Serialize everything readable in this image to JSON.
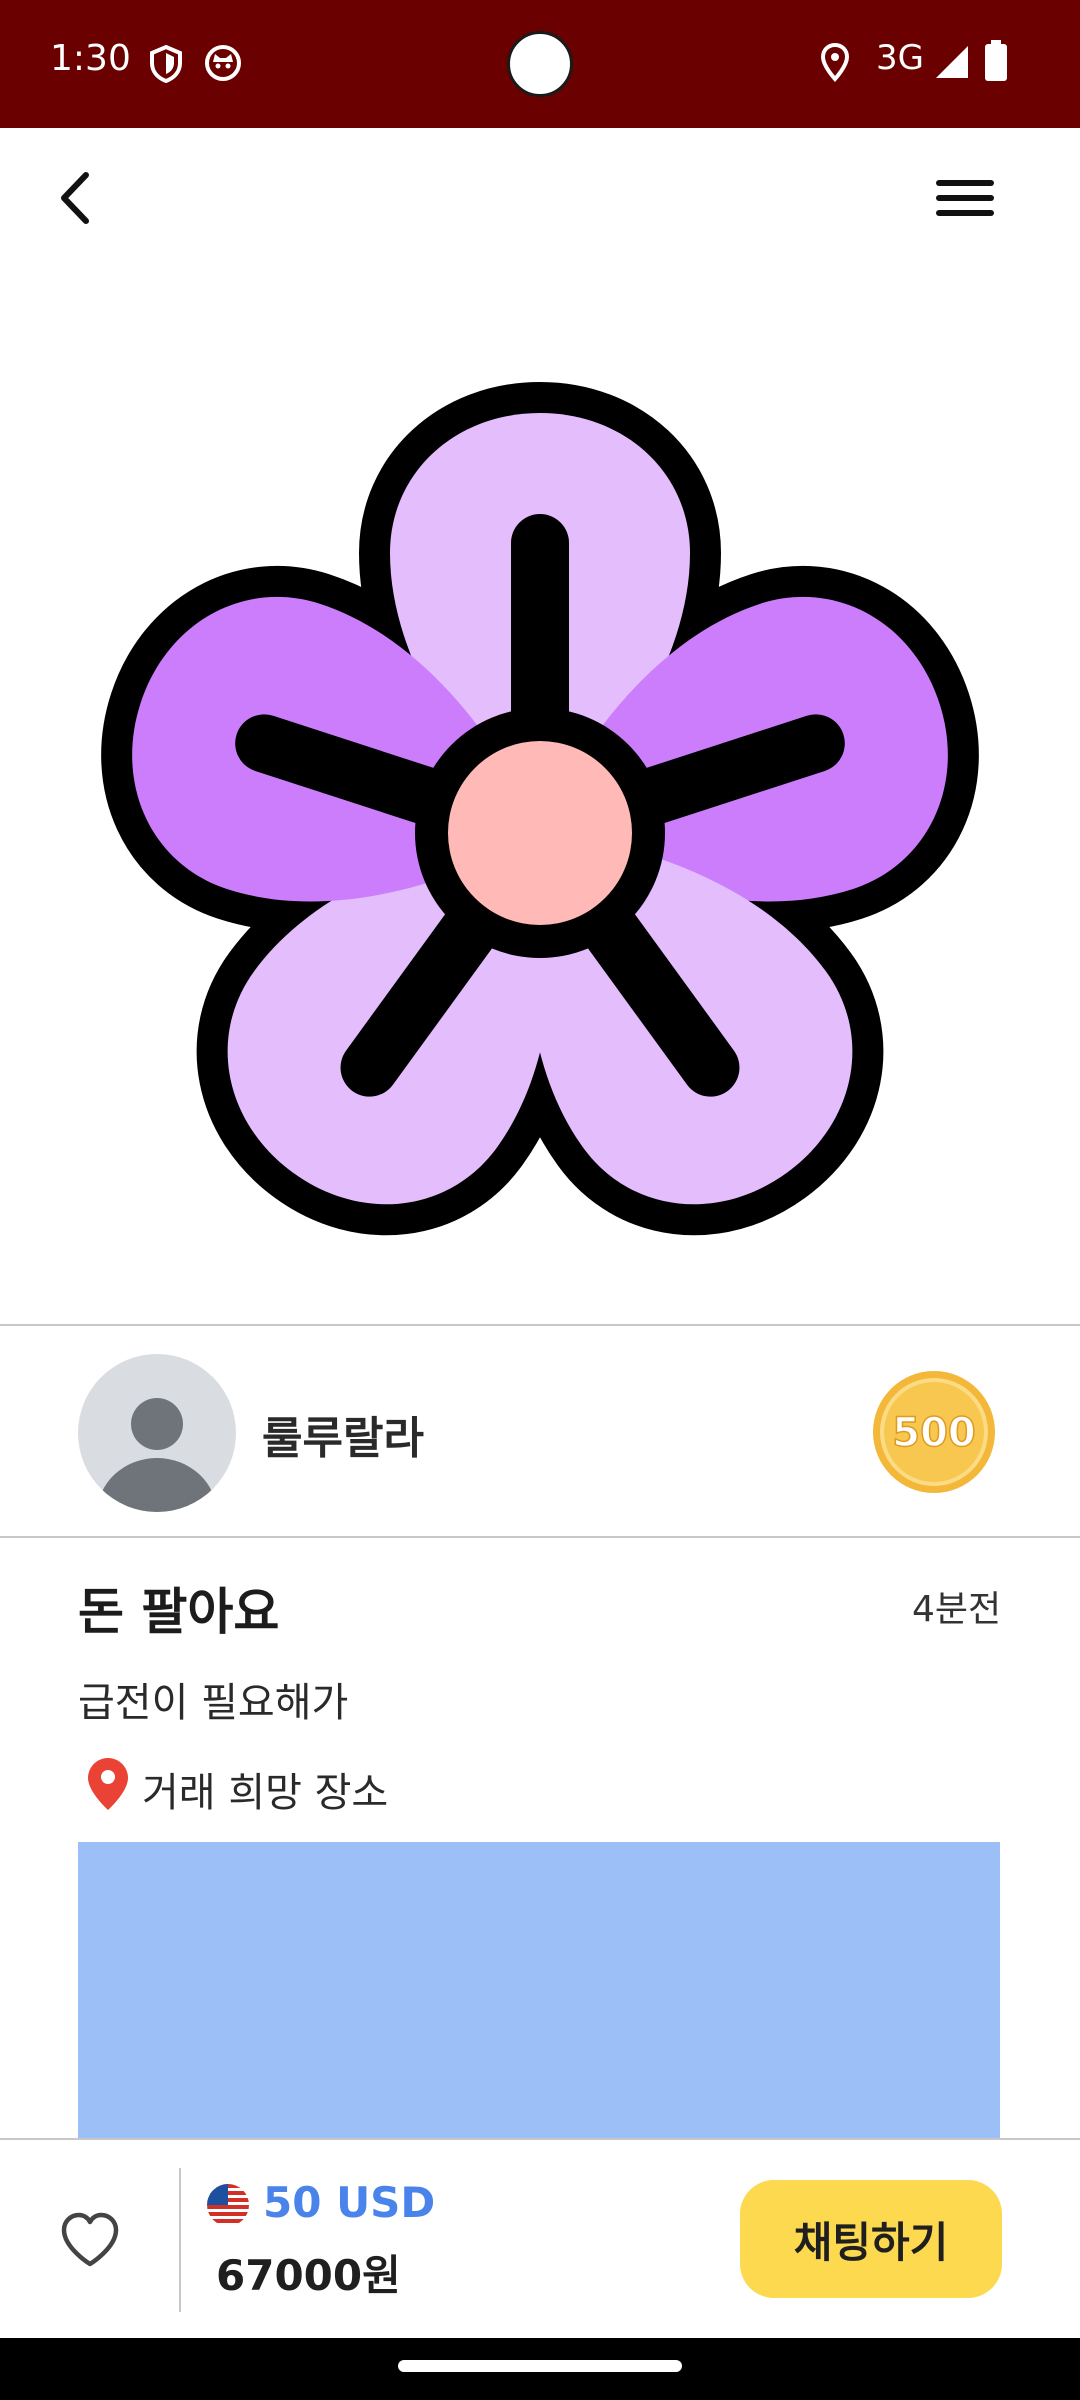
{
  "status_bar": {
    "time": "1:30",
    "network": "3G",
    "icons": [
      "shield-icon",
      "cat-icon",
      "location-icon",
      "signal-icon",
      "battery-icon"
    ]
  },
  "app_bar": {
    "back_icon": "chevron-left-icon",
    "menu_icon": "hamburger-menu-icon"
  },
  "hero": {
    "image": "purple-flower-illustration",
    "colors": {
      "outline": "#000000",
      "petal_light": "#e4bdfc",
      "petal_dark": "#cb7dfc",
      "center": "#ffbab7"
    }
  },
  "seller": {
    "name": "룰루랄라",
    "badge_value": "500"
  },
  "post": {
    "title": "돈 팔아요",
    "time_ago": "4분전",
    "description": "급전이 필요해가",
    "location_label": "거래 희망 장소"
  },
  "bottom_bar": {
    "usd_price": "50 USD",
    "krw_price": "67000원",
    "chat_button": "채팅하기"
  },
  "colors": {
    "status_bar": "#6b0000",
    "accent_blue": "#4a84ea",
    "map_placeholder": "#9dbff8",
    "chat_button": "#fcd94e",
    "pin": "#ea4335"
  }
}
